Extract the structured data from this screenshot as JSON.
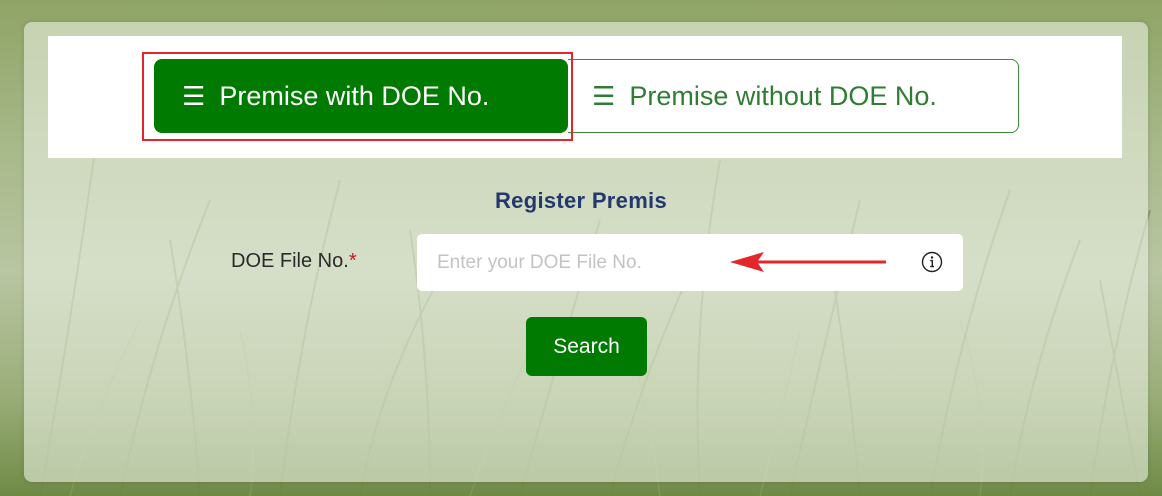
{
  "tabs": {
    "with_doe": {
      "label": "Premise with DOE No.",
      "icon": "list-icon"
    },
    "without_doe": {
      "label": "Premise without DOE No.",
      "icon": "list-icon"
    },
    "list_glyph": "☰"
  },
  "form": {
    "title": "Register Premis",
    "doe_file_label": "DOE File No.",
    "required_mark": "*",
    "doe_file_placeholder": "Enter your DOE File No.",
    "doe_file_value": "",
    "search_label": "Search"
  },
  "colors": {
    "accent_green": "#007a00",
    "highlight_red": "#e2262a",
    "title_navy": "#24386e"
  }
}
